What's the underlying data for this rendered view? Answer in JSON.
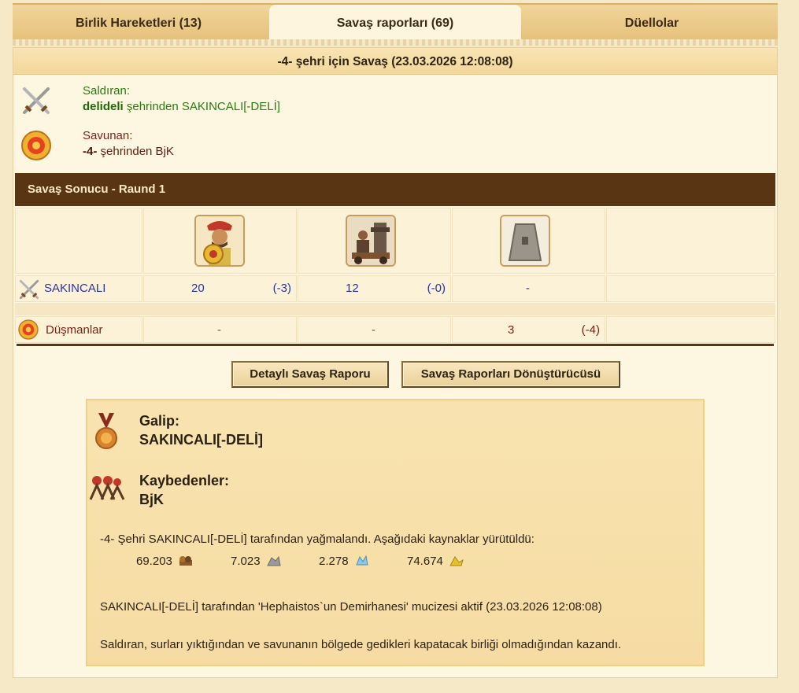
{
  "tabs": [
    {
      "label": "Birlik Hareketleri (13)",
      "active": false
    },
    {
      "label": "Savaş raporları (69)",
      "active": true
    },
    {
      "label": "Düellolar",
      "active": false
    }
  ],
  "report": {
    "title": "-4- şehri için Savaş (23.03.2026 12:08:08)",
    "attacker": {
      "label": "Saldıran:",
      "city": "delideli",
      "suffix": " şehrinden SAKINCALI[-DELİ]"
    },
    "defender": {
      "label": "Savunan:",
      "city": "-4-",
      "suffix": " şehrinden BjK"
    },
    "result_header": "Savaş Sonucu - Raund 1",
    "units": [
      {
        "icon": "hoplite-unit-icon"
      },
      {
        "icon": "catapult-unit-icon"
      },
      {
        "icon": "city-wall-icon"
      }
    ],
    "rows": [
      {
        "name": "SAKINCALI",
        "icon": "crossed-swords-icon",
        "values": [
          {
            "count": "20",
            "loss": "(-3)"
          },
          {
            "count": "12",
            "loss": "(-0)"
          },
          {
            "count": "-",
            "loss": ""
          }
        ]
      },
      {
        "name": "Düşmanlar",
        "icon": "shield-icon",
        "values": [
          {
            "count": "-",
            "loss": ""
          },
          {
            "count": "-",
            "loss": ""
          },
          {
            "count": "3",
            "loss": "(-4)"
          }
        ]
      }
    ],
    "buttons": {
      "detailed": "Detaylı Savaş Raporu",
      "converter": "Savaş Raporları Dönüştürücüsü"
    },
    "winner": {
      "label": "Galip:",
      "name": "SAKINCALI[-DELİ]"
    },
    "losers": {
      "label": "Kaybedenler:",
      "name": "BjK"
    },
    "plunder_text": "-4- Şehri SAKINCALI[-DELİ] tarafından yağmalandı. Aşağıdaki kaynaklar yürütüldü:",
    "resources": [
      {
        "amount": "69.203",
        "icon": "wood-icon"
      },
      {
        "amount": "7.023",
        "icon": "marble-icon"
      },
      {
        "amount": "2.278",
        "icon": "crystal-icon"
      },
      {
        "amount": "74.674",
        "icon": "sulfur-icon"
      }
    ],
    "wonder_text": "SAKINCALI[-DELİ] tarafından 'Hephaistos`un Demirhanesi' mucizesi aktif (23.03.2026 12:08:08)",
    "reason_text": "Saldıran, surları yıktığından ve savunanın bölgede gedikleri kapatacak birliği olmadığından kazandı."
  },
  "colors": {
    "header_bar": "#5a3514",
    "attacker_text": "#2b7a12",
    "defender_text": "#7a2416",
    "count_blue": "#2b33a8"
  }
}
